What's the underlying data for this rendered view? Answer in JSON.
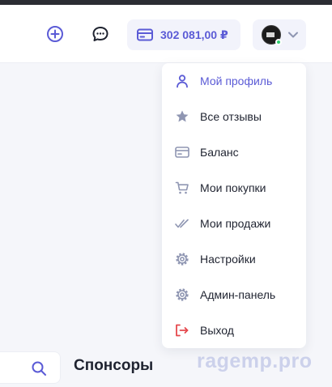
{
  "header": {
    "add_icon": "plus-circle-icon",
    "chat_icon": "chat-bubble-icon",
    "balance": {
      "icon": "card-icon",
      "amount": "302 081,00 ₽"
    },
    "user": {
      "avatar": "avatar",
      "status": "online",
      "chevron_icon": "chevron-down-icon"
    }
  },
  "menu": {
    "items": [
      {
        "label": "Мой профиль",
        "icon": "user-icon",
        "active": true
      },
      {
        "label": "Все отзывы",
        "icon": "star-icon"
      },
      {
        "label": "Баланс",
        "icon": "card-icon"
      },
      {
        "label": "Мои покупки",
        "icon": "cart-icon"
      },
      {
        "label": "Мои продажи",
        "icon": "double-check-icon"
      },
      {
        "label": "Настройки",
        "icon": "gear-icon"
      },
      {
        "label": "Админ-панель",
        "icon": "gear-icon"
      },
      {
        "label": "Выход",
        "icon": "logout-icon"
      }
    ]
  },
  "sponsors": {
    "title": "Спонсоры"
  },
  "watermark": "ragemp.pro",
  "colors": {
    "accent": "#5b5bd6",
    "text": "#1f2330",
    "icon_muted": "#9aa0b8",
    "logout": "#e5484d",
    "online": "#2ecc71",
    "background": "#f5f6fa"
  }
}
